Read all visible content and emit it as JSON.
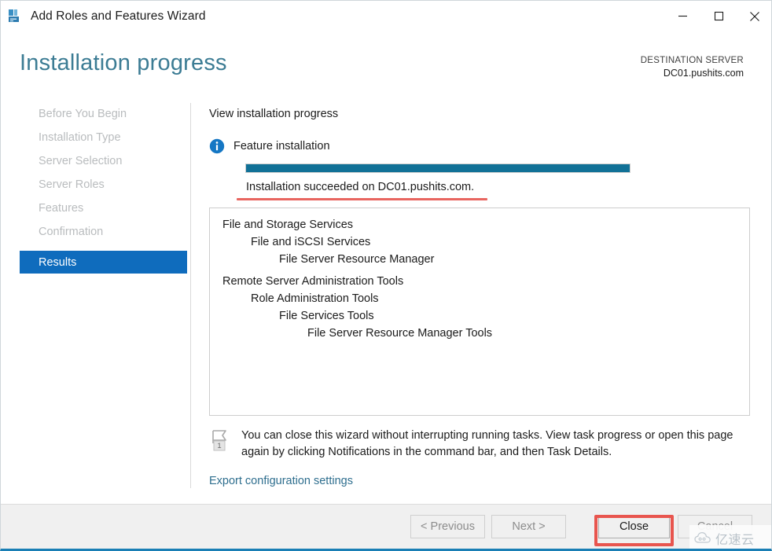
{
  "window": {
    "title": "Add Roles and Features Wizard",
    "icon": "server-roles-icon",
    "minimize_label": "—",
    "maximize_label": "□",
    "close_label": "✕"
  },
  "header": {
    "page_title": "Installation progress",
    "destination_label": "DESTINATION SERVER",
    "destination_server": "DC01.pushits.com"
  },
  "sidebar": {
    "items": [
      {
        "label": "Before You Begin",
        "active": false
      },
      {
        "label": "Installation Type",
        "active": false
      },
      {
        "label": "Server Selection",
        "active": false
      },
      {
        "label": "Server Roles",
        "active": false
      },
      {
        "label": "Features",
        "active": false
      },
      {
        "label": "Confirmation",
        "active": false
      },
      {
        "label": "Results",
        "active": true
      }
    ]
  },
  "content": {
    "heading": "View installation progress",
    "feature_installation_label": "Feature installation",
    "info_icon": "info-circle-icon",
    "progress_percent": 100,
    "progress_status": "Installation succeeded on DC01.pushits.com.",
    "results": [
      {
        "text": "File and Storage Services",
        "level": 0
      },
      {
        "text": "File and iSCSI Services",
        "level": 1
      },
      {
        "text": "File Server Resource Manager",
        "level": 2
      },
      {
        "text": "Remote Server Administration Tools",
        "level": 0
      },
      {
        "text": "Role Administration Tools",
        "level": 1
      },
      {
        "text": "File Services Tools",
        "level": 2
      },
      {
        "text": "File Server Resource Manager Tools",
        "level": 3
      }
    ],
    "note_icon": "notification-flag-icon",
    "note_badge": "1",
    "note_text": "You can close this wizard without interrupting running tasks. View task progress or open this page again by clicking Notifications in the command bar, and then Task Details.",
    "export_link": "Export configuration settings"
  },
  "footer": {
    "previous_label": "< Previous",
    "next_label": "Next >",
    "close_label": "Close",
    "cancel_label": "Cancel"
  },
  "watermark": {
    "text": "亿速云"
  },
  "colors": {
    "accent_blue": "#0f6cbd",
    "title_teal": "#3c7c94",
    "progress_teal": "#117197",
    "annotation_red": "#e8554e",
    "link_blue": "#2e6e8e",
    "disabled_gray": "#8c8c8c"
  }
}
